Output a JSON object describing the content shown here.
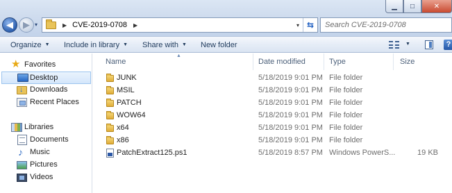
{
  "window": {
    "minimize_glyph": "▁",
    "maximize_glyph": "□",
    "close_glyph": "✕"
  },
  "navigation": {
    "back_glyph": "◀",
    "forward_glyph": "▶",
    "history_glyph": "▾"
  },
  "address_bar": {
    "separator_glyph": "▶",
    "path": "CVE-2019-0708",
    "dropdown_glyph": "▾",
    "refresh_glyph": "⇆"
  },
  "search": {
    "placeholder": "Search CVE-2019-0708"
  },
  "toolbar": {
    "organize": "Organize",
    "include_in_library": "Include in library",
    "share_with": "Share with",
    "new_folder": "New folder",
    "dropdown_glyph": "▼",
    "help_glyph": "?"
  },
  "sidebar": {
    "favorites": {
      "label": "Favorites",
      "items": [
        {
          "label": "Desktop",
          "selected": true
        },
        {
          "label": "Downloads"
        },
        {
          "label": "Recent Places"
        }
      ]
    },
    "libraries": {
      "label": "Libraries",
      "items": [
        {
          "label": "Documents"
        },
        {
          "label": "Music"
        },
        {
          "label": "Pictures"
        },
        {
          "label": "Videos"
        }
      ]
    }
  },
  "columns": {
    "name": "Name",
    "date_modified": "Date modified",
    "type": "Type",
    "size": "Size",
    "sort_glyph": "▲"
  },
  "files": [
    {
      "name": "JUNK",
      "date": "5/18/2019 9:01 PM",
      "type": "File folder",
      "size": "",
      "icon": "folder-icon"
    },
    {
      "name": "MSIL",
      "date": "5/18/2019 9:01 PM",
      "type": "File folder",
      "size": "",
      "icon": "folder-icon"
    },
    {
      "name": "PATCH",
      "date": "5/18/2019 9:01 PM",
      "type": "File folder",
      "size": "",
      "icon": "folder-icon"
    },
    {
      "name": "WOW64",
      "date": "5/18/2019 9:01 PM",
      "type": "File folder",
      "size": "",
      "icon": "folder-icon"
    },
    {
      "name": "x64",
      "date": "5/18/2019 9:01 PM",
      "type": "File folder",
      "size": "",
      "icon": "folder-icon"
    },
    {
      "name": "x86",
      "date": "5/18/2019 9:01 PM",
      "type": "File folder",
      "size": "",
      "icon": "folder-icon"
    },
    {
      "name": "PatchExtract125.ps1",
      "date": "5/18/2019 8:57 PM",
      "type": "Windows PowerS...",
      "size": "19 KB",
      "icon": "powershell-file-icon"
    }
  ]
}
